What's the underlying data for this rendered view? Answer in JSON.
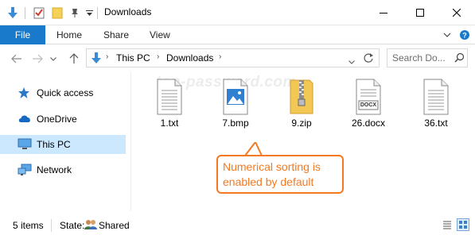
{
  "window": {
    "title": "Downloads",
    "minimize_icon": "minimize-icon",
    "maximize_icon": "maximize-icon",
    "close_icon": "close-icon"
  },
  "quick_access_toolbar": {
    "icons": [
      "download-arrow-icon",
      "properties-icon",
      "new-folder-icon",
      "pin-icon",
      "customize-dropdown-icon"
    ]
  },
  "ribbon": {
    "tabs": [
      "File",
      "Home",
      "Share",
      "View"
    ],
    "expand_icon": "chevron-down-icon",
    "help_icon": "help-icon"
  },
  "address_bar": {
    "breadcrumbs": [
      "This PC",
      "Downloads"
    ],
    "location_icon": "downloads-icon"
  },
  "search": {
    "placeholder": "Search Do..."
  },
  "nav_pane": {
    "items": [
      {
        "label": "Quick access",
        "icon": "star-icon",
        "selected": false
      },
      {
        "label": "OneDrive",
        "icon": "cloud-icon",
        "selected": false
      },
      {
        "label": "This PC",
        "icon": "monitor-icon",
        "selected": true
      },
      {
        "label": "Network",
        "icon": "network-icon",
        "selected": false
      }
    ]
  },
  "content": {
    "watermark": "top-password.com",
    "files": [
      {
        "name": "1.txt",
        "icon": "text-file-icon"
      },
      {
        "name": "7.bmp",
        "icon": "image-file-icon"
      },
      {
        "name": "9.zip",
        "icon": "zip-folder-icon"
      },
      {
        "name": "26.docx",
        "icon": "docx-file-icon"
      },
      {
        "name": "36.txt",
        "icon": "text-file-icon"
      }
    ],
    "callout": "Numerical sorting is enabled by default",
    "docx_badge": "DOCX"
  },
  "status_bar": {
    "item_count": "5 items",
    "state_label": "State:",
    "state_value": "Shared"
  },
  "colors": {
    "accent": "#1979ca",
    "selection": "#cce8ff",
    "callout": "#f47920"
  }
}
